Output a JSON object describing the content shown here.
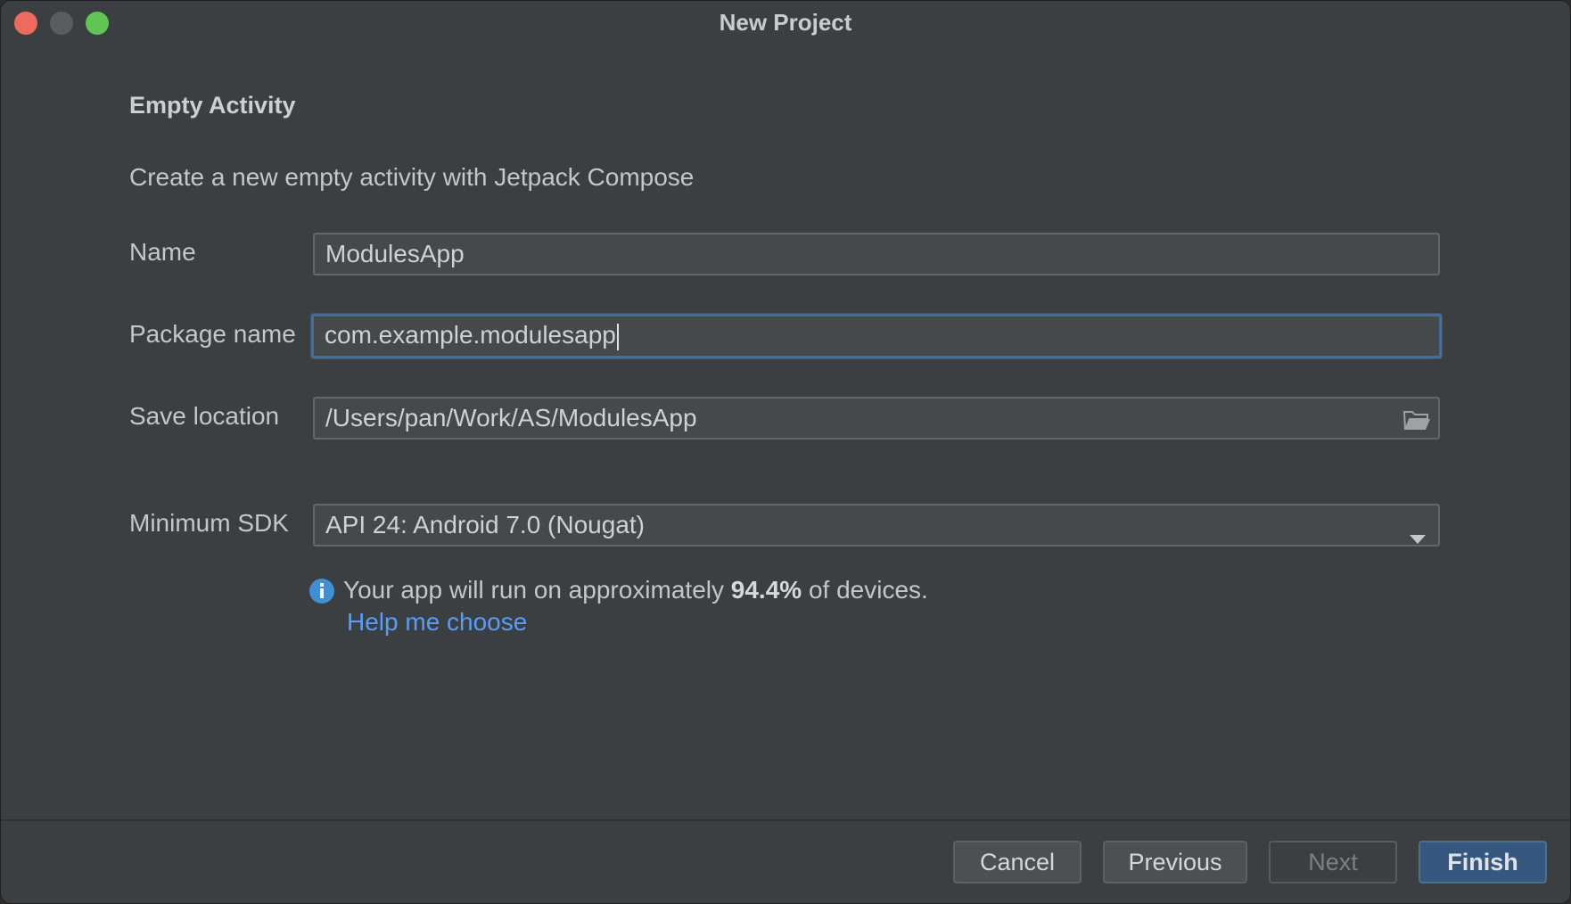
{
  "window": {
    "title": "New Project"
  },
  "form": {
    "section_title": "Empty Activity",
    "subtitle": "Create a new empty activity with Jetpack Compose",
    "name": {
      "label": "Name",
      "value": "ModulesApp"
    },
    "package_name": {
      "label": "Package name",
      "value": "com.example.modulesapp"
    },
    "save_location": {
      "label": "Save location",
      "value": "/Users/pan/Work/AS/ModulesApp",
      "icon": "folder-icon"
    },
    "minimum_sdk": {
      "label": "Minimum SDK",
      "value": "API 24: Android 7.0 (Nougat)"
    }
  },
  "info": {
    "icon": "info-icon",
    "prefix": "Your app will run on approximately",
    "percent": "94.4%",
    "suffix": "of devices.",
    "help_link": "Help me choose"
  },
  "buttons": {
    "cancel": "Cancel",
    "previous": "Previous",
    "next": "Next",
    "finish": "Finish"
  },
  "colors": {
    "accent": "#589df6",
    "primary_button": "#365880",
    "focus_border": "#466d94"
  }
}
